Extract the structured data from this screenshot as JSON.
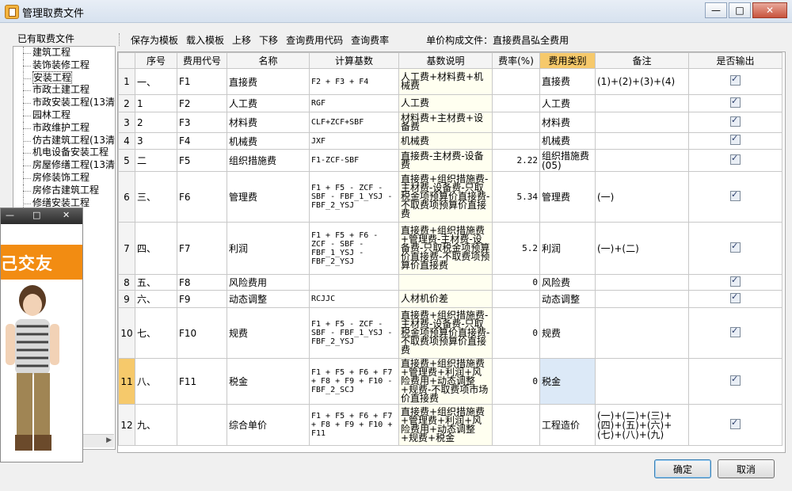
{
  "window": {
    "title": "管理取费文件",
    "minimize": "—",
    "maximize": "□",
    "close": "✕"
  },
  "left_panel": {
    "title": "已有取费文件",
    "items": [
      "建筑工程",
      "装饰装修工程",
      "安装工程",
      "市政土建工程",
      "市政安装工程(13清",
      "园林工程",
      "市政维护工程",
      "仿古建筑工程(13清",
      "机电设备安装工程",
      "房屋修缮工程(13清",
      "房修装饰工程",
      "房修古建筑工程",
      "修缮安装工程"
    ],
    "selected_index": 2
  },
  "toolbar": {
    "items": [
      "保存为模板",
      "载入模板",
      "上移",
      "下移",
      "查询费用代码",
      "查询费率"
    ],
    "info": "单价构成文件：直接费昌弘全费用"
  },
  "table": {
    "headers": [
      "序号",
      "费用代号",
      "名称",
      "计算基数",
      "基数说明",
      "费率(%)",
      "费用类别",
      "备注",
      "是否输出"
    ],
    "rows": [
      {
        "n": "1",
        "seq": "一、",
        "code": "F1",
        "name": "直接费",
        "base": "F2 + F3 + F4",
        "desc": "人工费+材料费+机械费",
        "rate": "",
        "cat": "直接费",
        "note": "(1)+(2)+(3)+(4)"
      },
      {
        "n": "2",
        "seq": "1",
        "code": "F2",
        "name": "人工费",
        "base": "RGF",
        "desc": "人工费",
        "rate": "",
        "cat": "人工费",
        "note": ""
      },
      {
        "n": "3",
        "seq": "2",
        "code": "F3",
        "name": "材料费",
        "base": "CLF+ZCF+SBF",
        "desc": "材料费+主材费+设备费",
        "rate": "",
        "cat": "材料费",
        "note": ""
      },
      {
        "n": "4",
        "seq": "3",
        "code": "F4",
        "name": "机械费",
        "base": "JXF",
        "desc": "机械费",
        "rate": "",
        "cat": "机械费",
        "note": ""
      },
      {
        "n": "5",
        "seq": "二",
        "code": "F5",
        "name": "组织措施费",
        "base": "F1-ZCF-SBF",
        "desc": "直接费-主材费-设备费",
        "rate": "2.22",
        "cat": "组织措施费(05)",
        "note": ""
      },
      {
        "n": "6",
        "seq": "三、",
        "code": "F6",
        "name": "管理费",
        "base": "F1 + F5 - ZCF - SBF - FBF_1_YSJ - FBF_2_YSJ",
        "desc": "直接费+组织措施费-主材费-设备费-只取税金项预算价直接费-不取费项预算价直接费",
        "rate": "5.34",
        "cat": "管理费",
        "note": "(一)"
      },
      {
        "n": "7",
        "seq": "四、",
        "code": "F7",
        "name": "利润",
        "base": "F1 + F5 + F6 - ZCF - SBF - FBF_1_YSJ - FBF_2_YSJ",
        "desc": "直接费+组织措施费+管理费-主材费-设备费-只取税金项预算价直接费-不取费项预算价直接费",
        "rate": "5.2",
        "cat": "利润",
        "note": "(一)+(二)"
      },
      {
        "n": "8",
        "seq": "五、",
        "code": "F8",
        "name": "风险费用",
        "base": "",
        "desc": "",
        "rate": "0",
        "cat": "风险费",
        "note": ""
      },
      {
        "n": "9",
        "seq": "六、",
        "code": "F9",
        "name": "动态调整",
        "base": "RCJJC",
        "desc": "人材机价差",
        "rate": "",
        "cat": "动态调整",
        "note": ""
      },
      {
        "n": "10",
        "seq": "七、",
        "code": "F10",
        "name": "规费",
        "base": "F1 + F5 - ZCF - SBF - FBF_1_YSJ - FBF_2_YSJ",
        "desc": "直接费+组织措施费-主材费-设备费-只取税金项预算价直接费-不取费项预算价直接费",
        "rate": "0",
        "cat": "规费",
        "note": ""
      },
      {
        "n": "11",
        "seq": "八、",
        "code": "F11",
        "name": "税金",
        "base": "F1 + F5 + F6 + F7 + F8 + F9 + F10 - FBF_2_SCJ",
        "desc": "直接费+组织措施费+管理费+利润+风险费用+动态调整+规费-不取费项市场价直接费",
        "rate": "0",
        "cat": "税金",
        "note": ""
      },
      {
        "n": "12",
        "seq": "九、",
        "code": "",
        "name": "综合单价",
        "base": "F1 + F5 + F6 + F7 + F8 + F9 + F10 + F11",
        "desc": "直接费+组织措施费+管理费+利润+风险费用+动态调整+规费+税金",
        "rate": "",
        "cat": "工程造价",
        "note": "(一)+(二)+(三)+(四)+(五)+(六)+(七)+(八)+(九)"
      }
    ],
    "selected_row": 10
  },
  "buttons": {
    "ok": "确定",
    "cancel": "取消"
  },
  "overlay_ad": {
    "banner": "己交友",
    "controls": [
      "—",
      "□",
      "✕"
    ]
  },
  "colors": {
    "header_highlight": "#f6c96b",
    "selected_cell": "#dce9f7",
    "desc_bg": "#fffff0"
  }
}
